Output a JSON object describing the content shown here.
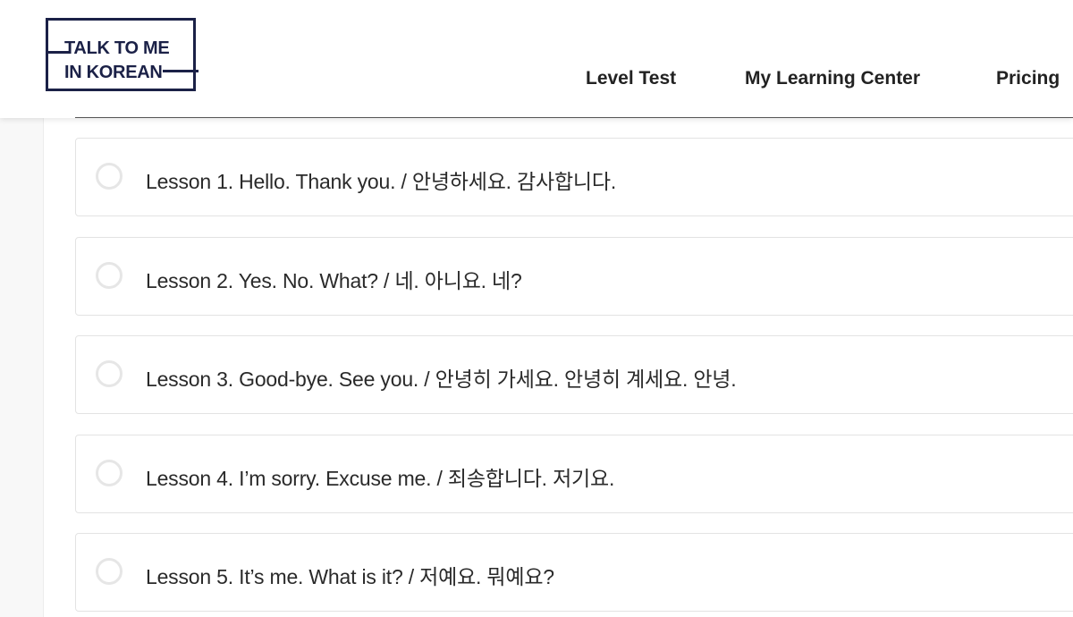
{
  "brand": {
    "logo_line1": "TALK TO ME",
    "logo_line2": "IN KOREAN",
    "color": "#1b2147"
  },
  "nav": {
    "items": [
      {
        "label": "Level Test"
      },
      {
        "label": "My Learning Center"
      },
      {
        "label": "Pricing"
      }
    ]
  },
  "lessons": [
    {
      "title": "Lesson 1. Hello. Thank you. / 안녕하세요. 감사합니다.",
      "completed": false
    },
    {
      "title": "Lesson 2. Yes. No. What? / 네. 아니요. 네?",
      "completed": false
    },
    {
      "title": "Lesson 3. Good-bye. See you. / 안녕히 가세요. 안녕히 계세요. 안녕.",
      "completed": false
    },
    {
      "title": "Lesson 4. I’m sorry. Excuse me. / 죄송합니다. 저기요.",
      "completed": false
    },
    {
      "title": "Lesson 5. It’s me. What is it? / 저예요. 뭐예요?",
      "completed": false
    }
  ]
}
